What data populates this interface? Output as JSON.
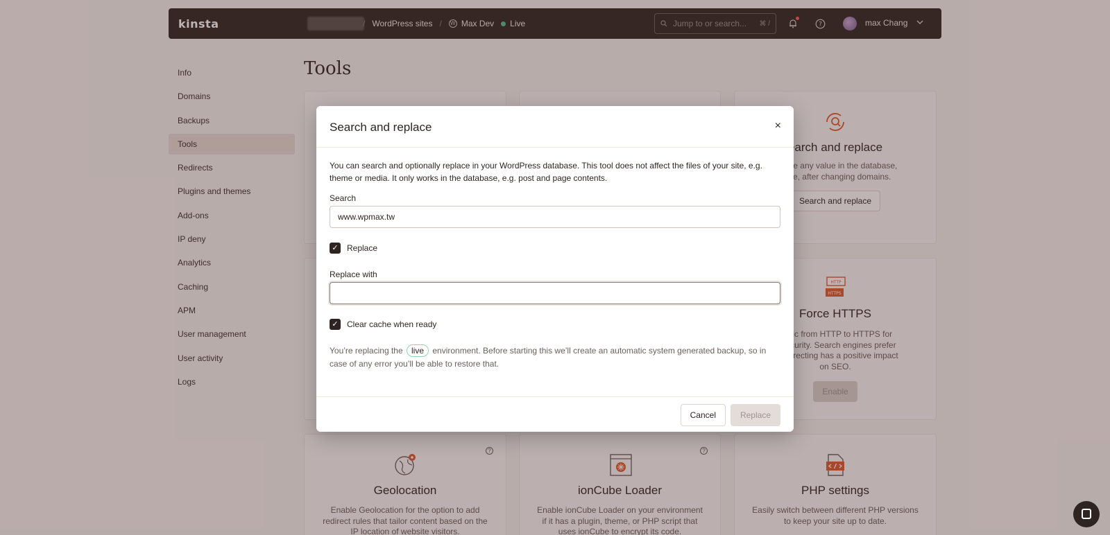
{
  "topbar": {
    "logo": "kinsta",
    "breadcrumb_sep": "/",
    "crumb_sites": "WordPress sites",
    "crumb_site": "Max Dev",
    "crumb_env": "Live",
    "search_placeholder": "Jump to or search...",
    "search_shortcut": "⌘ /",
    "username": "max Chang"
  },
  "sidebar": {
    "items": [
      {
        "label": "Info"
      },
      {
        "label": "Domains"
      },
      {
        "label": "Backups"
      },
      {
        "label": "Tools"
      },
      {
        "label": "Redirects"
      },
      {
        "label": "Plugins and themes"
      },
      {
        "label": "Add-ons"
      },
      {
        "label": "IP deny"
      },
      {
        "label": "Analytics"
      },
      {
        "label": "Caching"
      },
      {
        "label": "APM"
      },
      {
        "label": "User management"
      },
      {
        "label": "User activity"
      },
      {
        "label": "Logs"
      }
    ],
    "active": "Tools"
  },
  "page": {
    "title": "Tools"
  },
  "cards": {
    "search_replace": {
      "title": "earch and replace",
      "desc_1": "eplace any value in the database,",
      "desc_2": "mple, after changing domains.",
      "button": "Search and replace"
    },
    "force_https": {
      "title": "Force HTTPS",
      "desc_1": "traffic from HTTP to HTTPS for",
      "desc_2": "d security. Search engines prefer",
      "desc_3": "o redirecting has a positive impact",
      "desc_4": "on SEO.",
      "button": "Enable",
      "icon_top": "HTTP",
      "icon_bottom": "HTTPS"
    },
    "geolocation": {
      "title": "Geolocation",
      "desc_1": "Enable Geolocation for the option to add",
      "desc_2": "redirect rules that tailor content based on the",
      "desc_3": "IP location of website visitors."
    },
    "ioncube": {
      "title": "ionCube Loader",
      "desc_1": "Enable ionCube Loader on your environment",
      "desc_2": "if it has a plugin, theme, or PHP script that",
      "desc_3": "uses ionCube to encrypt its code."
    },
    "php": {
      "title": "PHP settings",
      "desc_1": "Easily switch between different PHP versions",
      "desc_2": "to keep your site up to date."
    }
  },
  "modal": {
    "title": "Search and replace",
    "close": "×",
    "description": "You can search and optionally replace in your WordPress database. This tool does not affect the files of your site, e.g. theme or media. It only works in the database, e.g. post and page contents.",
    "search_label": "Search",
    "search_value": "www.wpmax.tw",
    "replace_checkbox_label": "Replace",
    "replace_with_label": "Replace with",
    "replace_with_value": "",
    "clear_cache_label": "Clear cache when ready",
    "check_mark": "✓",
    "notice_before": "You’re replacing the",
    "notice_env": "live",
    "notice_after": "environment. Before starting this we’ll create an automatic system generated backup, so in case of any error you’ll be able to restore that.",
    "cancel": "Cancel",
    "replace": "Replace"
  },
  "icons": {
    "help": "?"
  }
}
